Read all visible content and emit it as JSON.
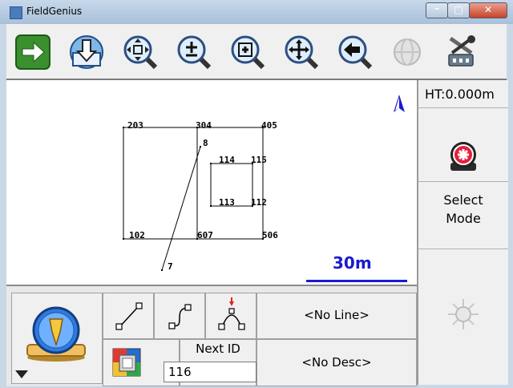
{
  "window": {
    "title": "FieldGenius"
  },
  "toolbar": {
    "icons": [
      "right-arrow-icon",
      "download-icon",
      "zoom-extents-icon",
      "zoom-in-out-icon",
      "zoom-window-icon",
      "pan-icon",
      "zoom-previous-icon",
      "globe-icon",
      "instrument-settings-icon"
    ]
  },
  "map": {
    "points": [
      {
        "label": "203"
      },
      {
        "label": "304"
      },
      {
        "label": "405"
      },
      {
        "label": "8"
      },
      {
        "label": "114"
      },
      {
        "label": "115"
      },
      {
        "label": "113"
      },
      {
        "label": "112"
      },
      {
        "label": "102"
      },
      {
        "label": "607"
      },
      {
        "label": "506"
      },
      {
        "label": "7"
      }
    ],
    "north_arrow": "north-arrow-icon",
    "scale": "30m",
    "colors": {
      "scale": "#1a1ad0"
    }
  },
  "right_panel": {
    "ht": "HT:0.000m",
    "select_mode_line1": "Select",
    "select_mode_line2": "Mode"
  },
  "bottom": {
    "no_line": "<No Line>",
    "no_desc": "<No Desc>",
    "next_id_label": "Next ID",
    "next_id_value": "116"
  }
}
